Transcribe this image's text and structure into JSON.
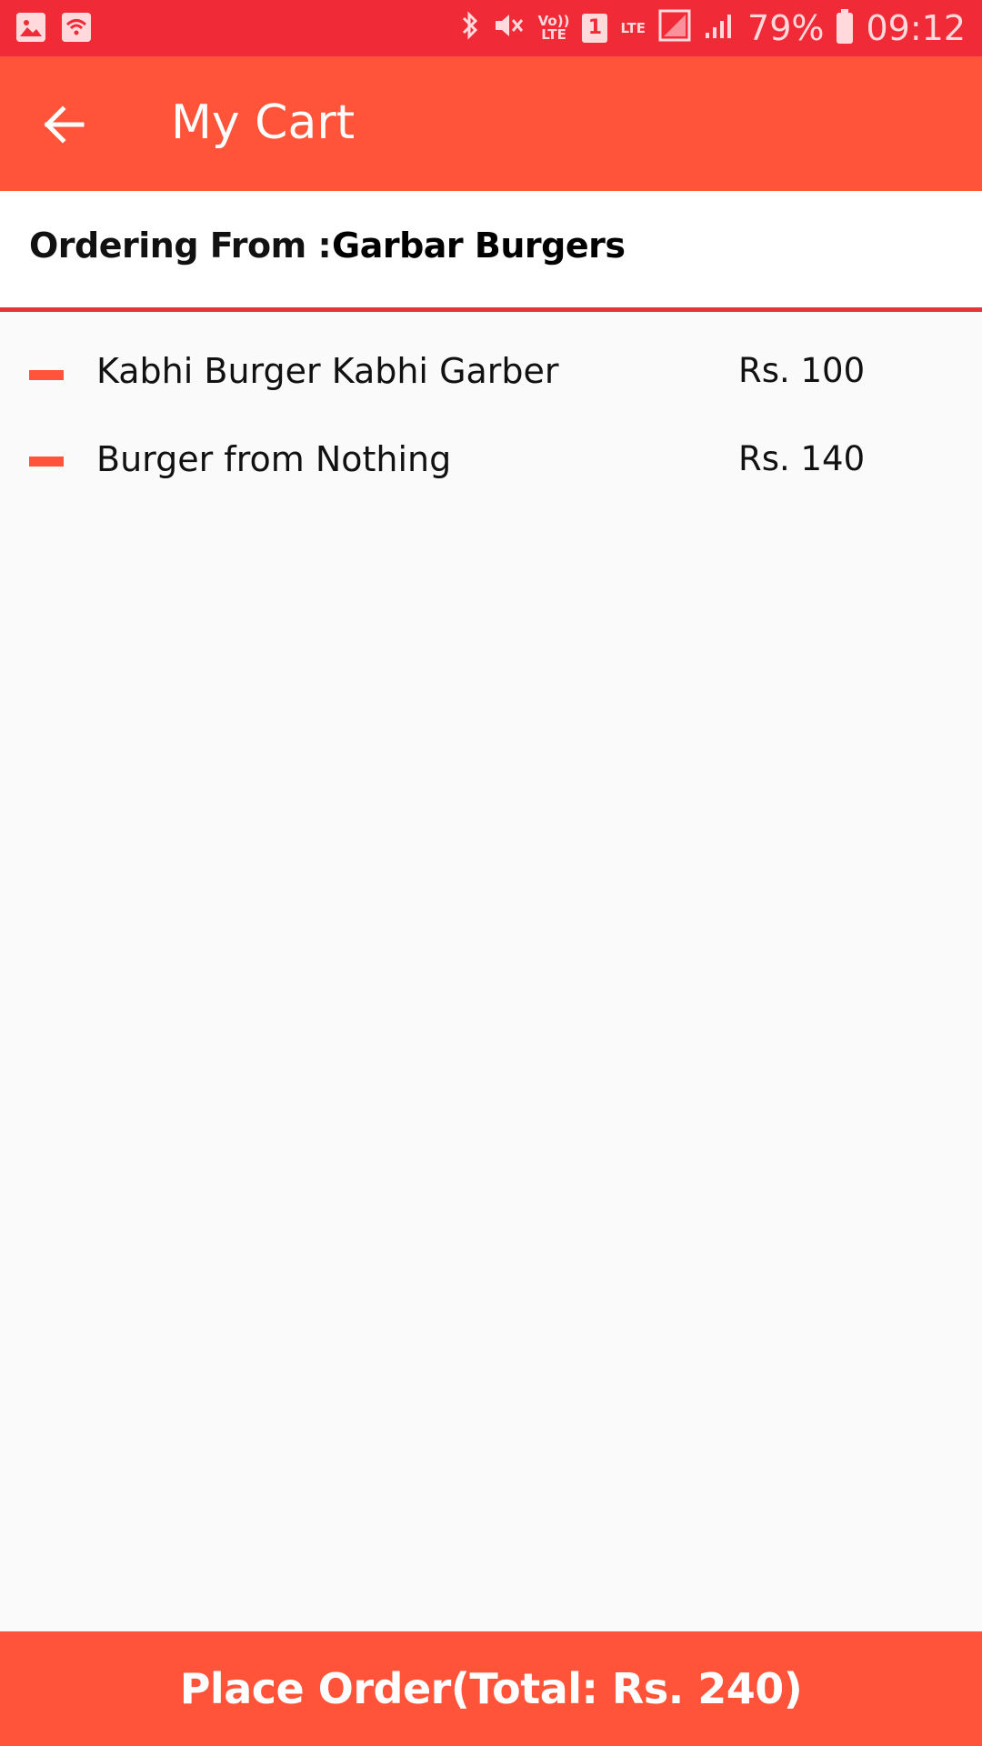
{
  "status_bar": {
    "volte_label": "Vo))\nLTE",
    "sim_slot": "1",
    "lte_label": "LTE",
    "battery": "79%",
    "time": "09:12",
    "icons": [
      "image-icon",
      "wifi-calling-icon",
      "bluetooth-icon",
      "mute-icon",
      "volte-icon",
      "sim-icon",
      "lte-icon",
      "signal-icon",
      "signal-icon-2",
      "battery-icon"
    ]
  },
  "app_bar": {
    "back_icon": "arrow-left-icon",
    "title": "My Cart"
  },
  "ordering": {
    "label": "Ordering From :",
    "restaurant": "Garbar Burgers"
  },
  "cart": {
    "items": [
      {
        "name": "Kabhi Burger Kabhi Garber",
        "price": "Rs. 100",
        "remove_icon": "minus-icon"
      },
      {
        "name": "Burger from Nothing",
        "price": "Rs. 140",
        "remove_icon": "minus-icon"
      }
    ]
  },
  "footer": {
    "place_order_label": "Place Order(Total: Rs. 240)"
  },
  "colors": {
    "status_bar": "#f02a37",
    "primary": "#ff533a",
    "divider": "#e8333c",
    "background": "#fafafa"
  }
}
